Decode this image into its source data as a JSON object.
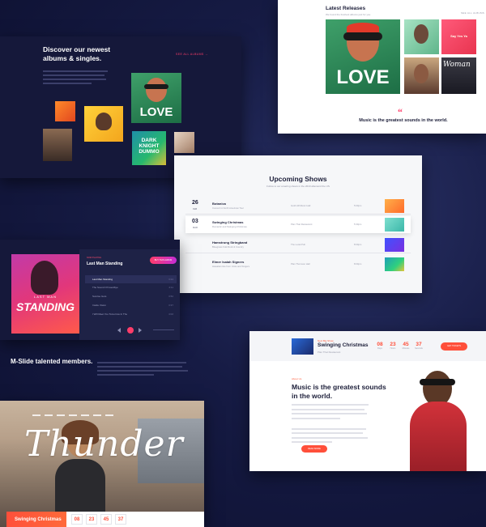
{
  "albums": {
    "title": "Discover our newest albums & singles.",
    "link": "SEE ALL ALBUMS →",
    "cover_texts": [
      "LOVE",
      "DARK KNIGHT DUMMO"
    ]
  },
  "releases": {
    "title": "Latest Releases",
    "subtitle": "We found the freshest albums just for you",
    "see_all": "SEE ALL ALBUMS",
    "cover_text": "LOVE",
    "small_covers": [
      "Say Yes Ya",
      "Woman"
    ],
    "quote_mark": "“",
    "quote": "Music is the greatest sounds in the world."
  },
  "shows": {
    "title": "Upcoming Shows",
    "subtitle": "Follow to our amazing shows in the 2019 afterword the US",
    "rows": [
      {
        "day": "26",
        "month": "FEB",
        "name": "Botanica",
        "place": "Concert in North American Tour",
        "venue": "Gold Hill Music Hall",
        "time": "5:00pm"
      },
      {
        "day": "03",
        "month": "MAR",
        "name": "Swinging Christmas",
        "place": "Romantic and Swinging Christmas",
        "venue": "Plan That Restaurant",
        "time": "5:30pm"
      },
      {
        "day": "",
        "month": "",
        "name": "Hamstrung Stringband",
        "place": "Bluegrass Folk Rock & Country",
        "venue": "The Local Pub",
        "time": "8:00pm"
      },
      {
        "day": "",
        "month": "",
        "name": "Elmer Isaiah Signers",
        "place": "Hawaiian Isle from Unite and Singers",
        "venue": "Plan Thomson Hall",
        "time": "8:00pm"
      }
    ]
  },
  "player": {
    "cover_title": "STANDING",
    "cover_subtitle": "LAST MAN",
    "eyebrow": "NOW PLAYING",
    "track": "Last Man Standing",
    "button": "BUY THIS ALBUM",
    "playlist": [
      {
        "name": "Last Man Standing",
        "dur": "3:24"
      },
      {
        "name": "The Sound Of Goodbye",
        "dur": "4:11"
      },
      {
        "name": "Sunrise Guts",
        "dur": "3:52"
      },
      {
        "name": "Inside Vision",
        "dur": "3:37"
      },
      {
        "name": "I Will Meet You Tomorrow In The",
        "dur": "4:02"
      }
    ]
  },
  "mslide": {
    "title": "M-Slide talented members."
  },
  "event": {
    "eyebrow": "Next Big Show",
    "title": "Swinging Christmas",
    "place": "Plan That Restaurant",
    "countdown": [
      {
        "n": "08",
        "u": "Days"
      },
      {
        "n": "23",
        "u": "Hours"
      },
      {
        "n": "45",
        "u": "Minutes"
      },
      {
        "n": "37",
        "u": "Seconds"
      }
    ],
    "ticket": "GET TICKETS",
    "h_eyebrow": "About Us",
    "headline": "Music is the greatest sounds in the world.",
    "more": "READ MORE"
  },
  "hero": {
    "script": "Thunder",
    "bottom_title": "Swinging Christmas",
    "countdown": [
      "08",
      "23",
      "45",
      "37"
    ]
  }
}
